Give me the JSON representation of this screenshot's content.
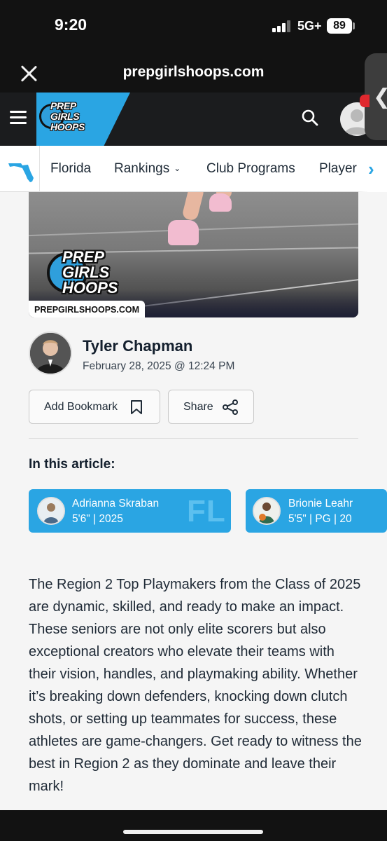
{
  "status_bar": {
    "time": "9:20",
    "network": "5G+",
    "battery": "89"
  },
  "browser": {
    "url": "prepgirlshoops.com",
    "close_icon": "close-icon",
    "edge_chevron": "❮"
  },
  "header": {
    "logo_lines": [
      "PREP",
      "GIRLS",
      "HOOPS"
    ],
    "menu_icon": "hamburger-icon",
    "search_icon": "search-icon"
  },
  "nav": {
    "items": [
      {
        "label": "Florida"
      },
      {
        "label": "Rankings"
      },
      {
        "label": "Club Programs"
      },
      {
        "label": "Player"
      }
    ],
    "rankings_chevron": "⌄",
    "next_arrow": "›"
  },
  "hero": {
    "logo_lines": [
      "PREP",
      "GIRLS",
      "HOOPS"
    ],
    "caption": "PREPGIRLSHOOPS.COM"
  },
  "author": {
    "name": "Tyler Chapman",
    "date": "February 28, 2025 @ 12:24 PM"
  },
  "actions": {
    "bookmark_label": "Add Bookmark",
    "share_label": "Share"
  },
  "in_article": {
    "title": "In this article:",
    "players": [
      {
        "name": "Adrianna Skraban",
        "meta": "5'6\" | 2025",
        "state": "FL"
      },
      {
        "name": "Brionie Leahr",
        "meta": "5'5\" | PG | 20"
      }
    ]
  },
  "article_text": "The Region 2 Top Playmakers from the Class of 2025 are dynamic, skilled, and ready to make an impact. These seniors are not only elite scorers but also exceptional creators who elevate their teams with their vision, handles, and playmaking ability. Whether it’s breaking down defenders, knocking down clutch shots, or setting up teammates for success, these athletes are game-changers. Get ready to witness the best in Region 2 as they dominate and leave their mark!",
  "colors": {
    "accent": "#2aa5e3",
    "header_bg": "#1b1c1e",
    "card_text": "#ffffff"
  }
}
